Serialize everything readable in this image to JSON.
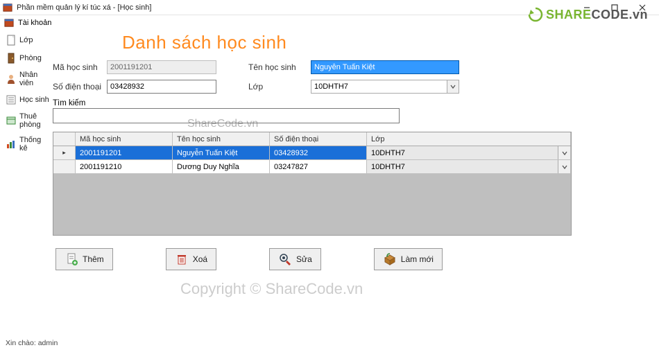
{
  "window": {
    "title": "Phần mềm quản lý kí túc xá - [Học sinh]"
  },
  "menubar": {
    "item1": "Tài khoản"
  },
  "sidebar": {
    "items": [
      {
        "label": "Lớp"
      },
      {
        "label": "Phòng"
      },
      {
        "label": "Nhân viên"
      },
      {
        "label": "Học sinh"
      },
      {
        "label": "Thuê phòng"
      },
      {
        "label": "Thống kê"
      }
    ]
  },
  "main": {
    "title": "Danh sách học sinh",
    "labels": {
      "mahocsinh": "Mã học sinh",
      "tenhocsinh": "Tên học sinh",
      "sodienthoai": "Số điện thoại",
      "lop": "Lớp",
      "timkiem": "Tìm kiếm"
    },
    "values": {
      "mahocsinh": "2001191201",
      "tenhocsinh": "Nguyễn Tuấn Kiệt",
      "sodienthoai": "03428932",
      "lop": "10DHTH7",
      "timkiem": ""
    }
  },
  "grid": {
    "headers": {
      "c1": "Mã học sinh",
      "c2": "Tên học sinh",
      "c3": "Số điện thoại",
      "c4": "Lớp"
    },
    "rows": [
      {
        "c1": "2001191201",
        "c2": "Nguyễn Tuấn Kiệt",
        "c3": "03428932",
        "c4": "10DHTH7"
      },
      {
        "c1": "2001191210",
        "c2": "Dương Duy Nghĩa",
        "c3": "03247827",
        "c4": "10DHTH7"
      }
    ]
  },
  "actions": {
    "add": "Thêm",
    "delete": "Xoá",
    "edit": "Sửa",
    "refresh": "Làm mới"
  },
  "status": {
    "text": "Xin chào: admin"
  },
  "watermark": {
    "logo1": "SHARE",
    "logo2": "CODE.vn",
    "center": "ShareCode.vn",
    "big": "Copyright © ShareCode.vn"
  }
}
